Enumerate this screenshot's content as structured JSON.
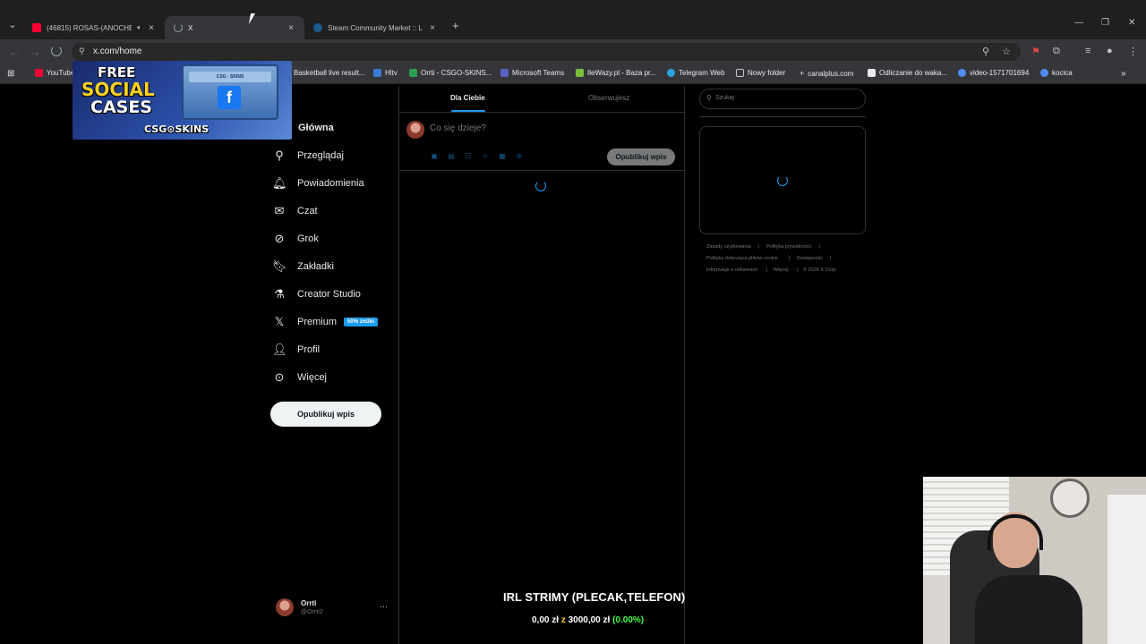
{
  "browser": {
    "tabs": [
      {
        "title": "(46815) ROSAS-(ANOCHE)(",
        "favicon": "youtube-icon",
        "active": false
      },
      {
        "title": "X",
        "favicon": "loading-icon",
        "active": true
      },
      {
        "title": "Steam Community Market :: List",
        "favicon": "steam-icon",
        "active": false
      }
    ],
    "url": "x.com/home",
    "bookmarks": [
      "YouTube",
      "Basketball live result...",
      "Hltv",
      "Orrti - CSGO-SKINS...",
      "Microsoft Teams",
      "IleWazy.pl - Baza pr...",
      "Telegram Web",
      "Nowy folder",
      "canalplus.com",
      "Odliczanie do waka...",
      "video-1571701694",
      "kocica"
    ]
  },
  "sidebar": {
    "items": [
      {
        "label": "Główna",
        "icon": "home-icon"
      },
      {
        "label": "Przeglądaj",
        "icon": "search-icon"
      },
      {
        "label": "Powiadomienia",
        "icon": "bell-icon"
      },
      {
        "label": "Czat",
        "icon": "mail-icon"
      },
      {
        "label": "Grok",
        "icon": "grok-icon"
      },
      {
        "label": "Zakładki",
        "icon": "bookmark-icon"
      },
      {
        "label": "Creator Studio",
        "icon": "flask-icon"
      },
      {
        "label": "Premium",
        "icon": "x-logo-icon"
      },
      {
        "label": "Profil",
        "icon": "person-icon"
      },
      {
        "label": "Więcej",
        "icon": "more-circle-icon"
      }
    ],
    "premium_badge": "50% zniżki",
    "post_button": "Opublikuj wpis",
    "profile": {
      "name": "Orrti",
      "handle": "@Orrti2"
    }
  },
  "feed": {
    "tabs": [
      "Dla Ciebie",
      "Obserwujesz"
    ],
    "composer_placeholder": "Co się dzieje?",
    "composer_post": "Opublikuj wpis"
  },
  "right_column": {
    "search_placeholder": "Szukaj",
    "footer": {
      "terms": "Zasady użytkowania",
      "privacy": "Polityka prywatności",
      "cookies": "Polityka dotycząca plików cookie",
      "accessibility": "Dostępność",
      "ads": "Informacje o reklamach",
      "more": "Więcej ···",
      "copyright": "© 2026 X Corp."
    }
  },
  "overlay": {
    "ad": {
      "line1": "FREE",
      "line2": "SOCIAL",
      "line3": "CASES",
      "brand": "CSG⊙SKINS",
      "box_label": "CSG · SKINS",
      "fb": "f"
    },
    "goal_title": "IRL STRIMY (PLECAK,TELEFON)",
    "goal_current": "0,00 zł",
    "goal_sep": "z",
    "goal_target": "3000,00 zł",
    "goal_percent": "(0.00%)"
  },
  "colors": {
    "accent": "#1d9bf0",
    "goal_percent": "#46ff46",
    "background": "#000000"
  }
}
